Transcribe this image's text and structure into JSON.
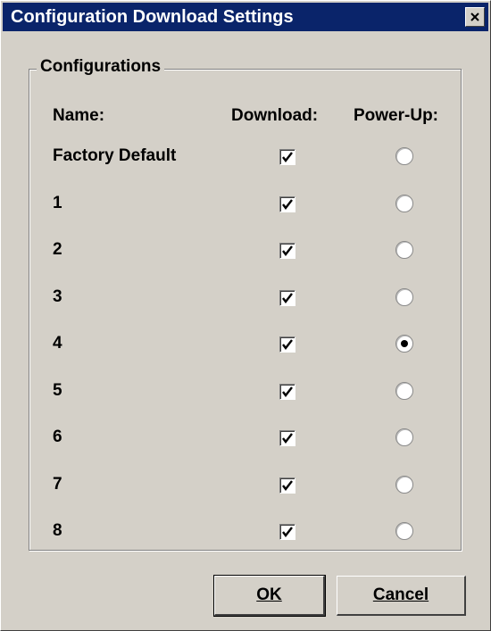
{
  "window": {
    "title": "Configuration Download Settings"
  },
  "group": {
    "label": "Configurations"
  },
  "headers": {
    "name": "Name:",
    "download": "Download:",
    "powerup": "Power-Up:"
  },
  "rows": [
    {
      "name": "Factory Default",
      "download": true,
      "powerup": false
    },
    {
      "name": "1",
      "download": true,
      "powerup": false
    },
    {
      "name": "2",
      "download": true,
      "powerup": false
    },
    {
      "name": "3",
      "download": true,
      "powerup": false
    },
    {
      "name": "4",
      "download": true,
      "powerup": true
    },
    {
      "name": "5",
      "download": true,
      "powerup": false
    },
    {
      "name": "6",
      "download": true,
      "powerup": false
    },
    {
      "name": "7",
      "download": true,
      "powerup": false
    },
    {
      "name": "8",
      "download": true,
      "powerup": false
    }
  ],
  "buttons": {
    "ok": "OK",
    "cancel": "Cancel"
  }
}
